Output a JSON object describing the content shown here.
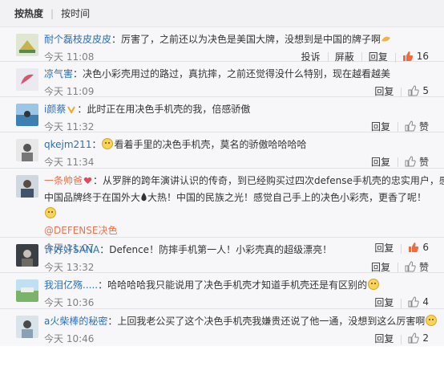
{
  "sort": {
    "hot": "按热度",
    "time": "按时间"
  },
  "actions": {
    "report": "投诉",
    "block": "屏蔽",
    "reply": "回复",
    "like": "赞"
  },
  "comments": [
    {
      "user": "耐个磊枝皮皮皮",
      "text": "：厉害了，之前还以为决色是美国大牌，没想到是中国的牌子啊",
      "time": "今天 11:08",
      "likes": "16"
    },
    {
      "user": "凉气害",
      "text": "：决色小彩壳用过的路过，真抗摔，之前还觉得没什么特别，现在越看越美",
      "time": "今天 11:09",
      "likes": "5"
    },
    {
      "user": "i颜蔡",
      "text": "：此时正在用决色手机壳的我，倍感骄傲",
      "time": "今天 11:32",
      "likes": "赞"
    },
    {
      "user": "qkejm211",
      "text": "看着手里的决色手机壳，莫名的骄傲哈哈哈哈",
      "time": "今天 11:34",
      "likes": "赞"
    },
    {
      "user": "一条帅爸",
      "text": "：从罗胖的跨年演讲认识的传奇，到已经购买过四次defense手机壳的忠实用户，感慨",
      "text2a": "中国品牌终于在国外大",
      "text2b": "大热！中国的民族之光！感觉自己手上的决色小彩壳，更香了呢！",
      "mention": "@DEFENSE决色",
      "time": "今天 11:07",
      "likes": "6"
    },
    {
      "user": "许好好SANA",
      "text": "：Defence！防摔手机第一人！小彩壳真的超级漂亮！",
      "time": "今天 13:32",
      "likes": "赞"
    },
    {
      "user": "我泪亿殇.....",
      "text": "：哈哈哈哈我只能说用了决色手机壳才知道手机壳还是有区别的",
      "time": "今天 10:36",
      "likes": "4"
    },
    {
      "user": "a火柴棒的秘密",
      "text": "：上回我老公买了这个决色手机壳我嫌贵还说了他一通，没想到这么厉害啊",
      "time": "今天 10:46",
      "likes": "2"
    }
  ]
}
